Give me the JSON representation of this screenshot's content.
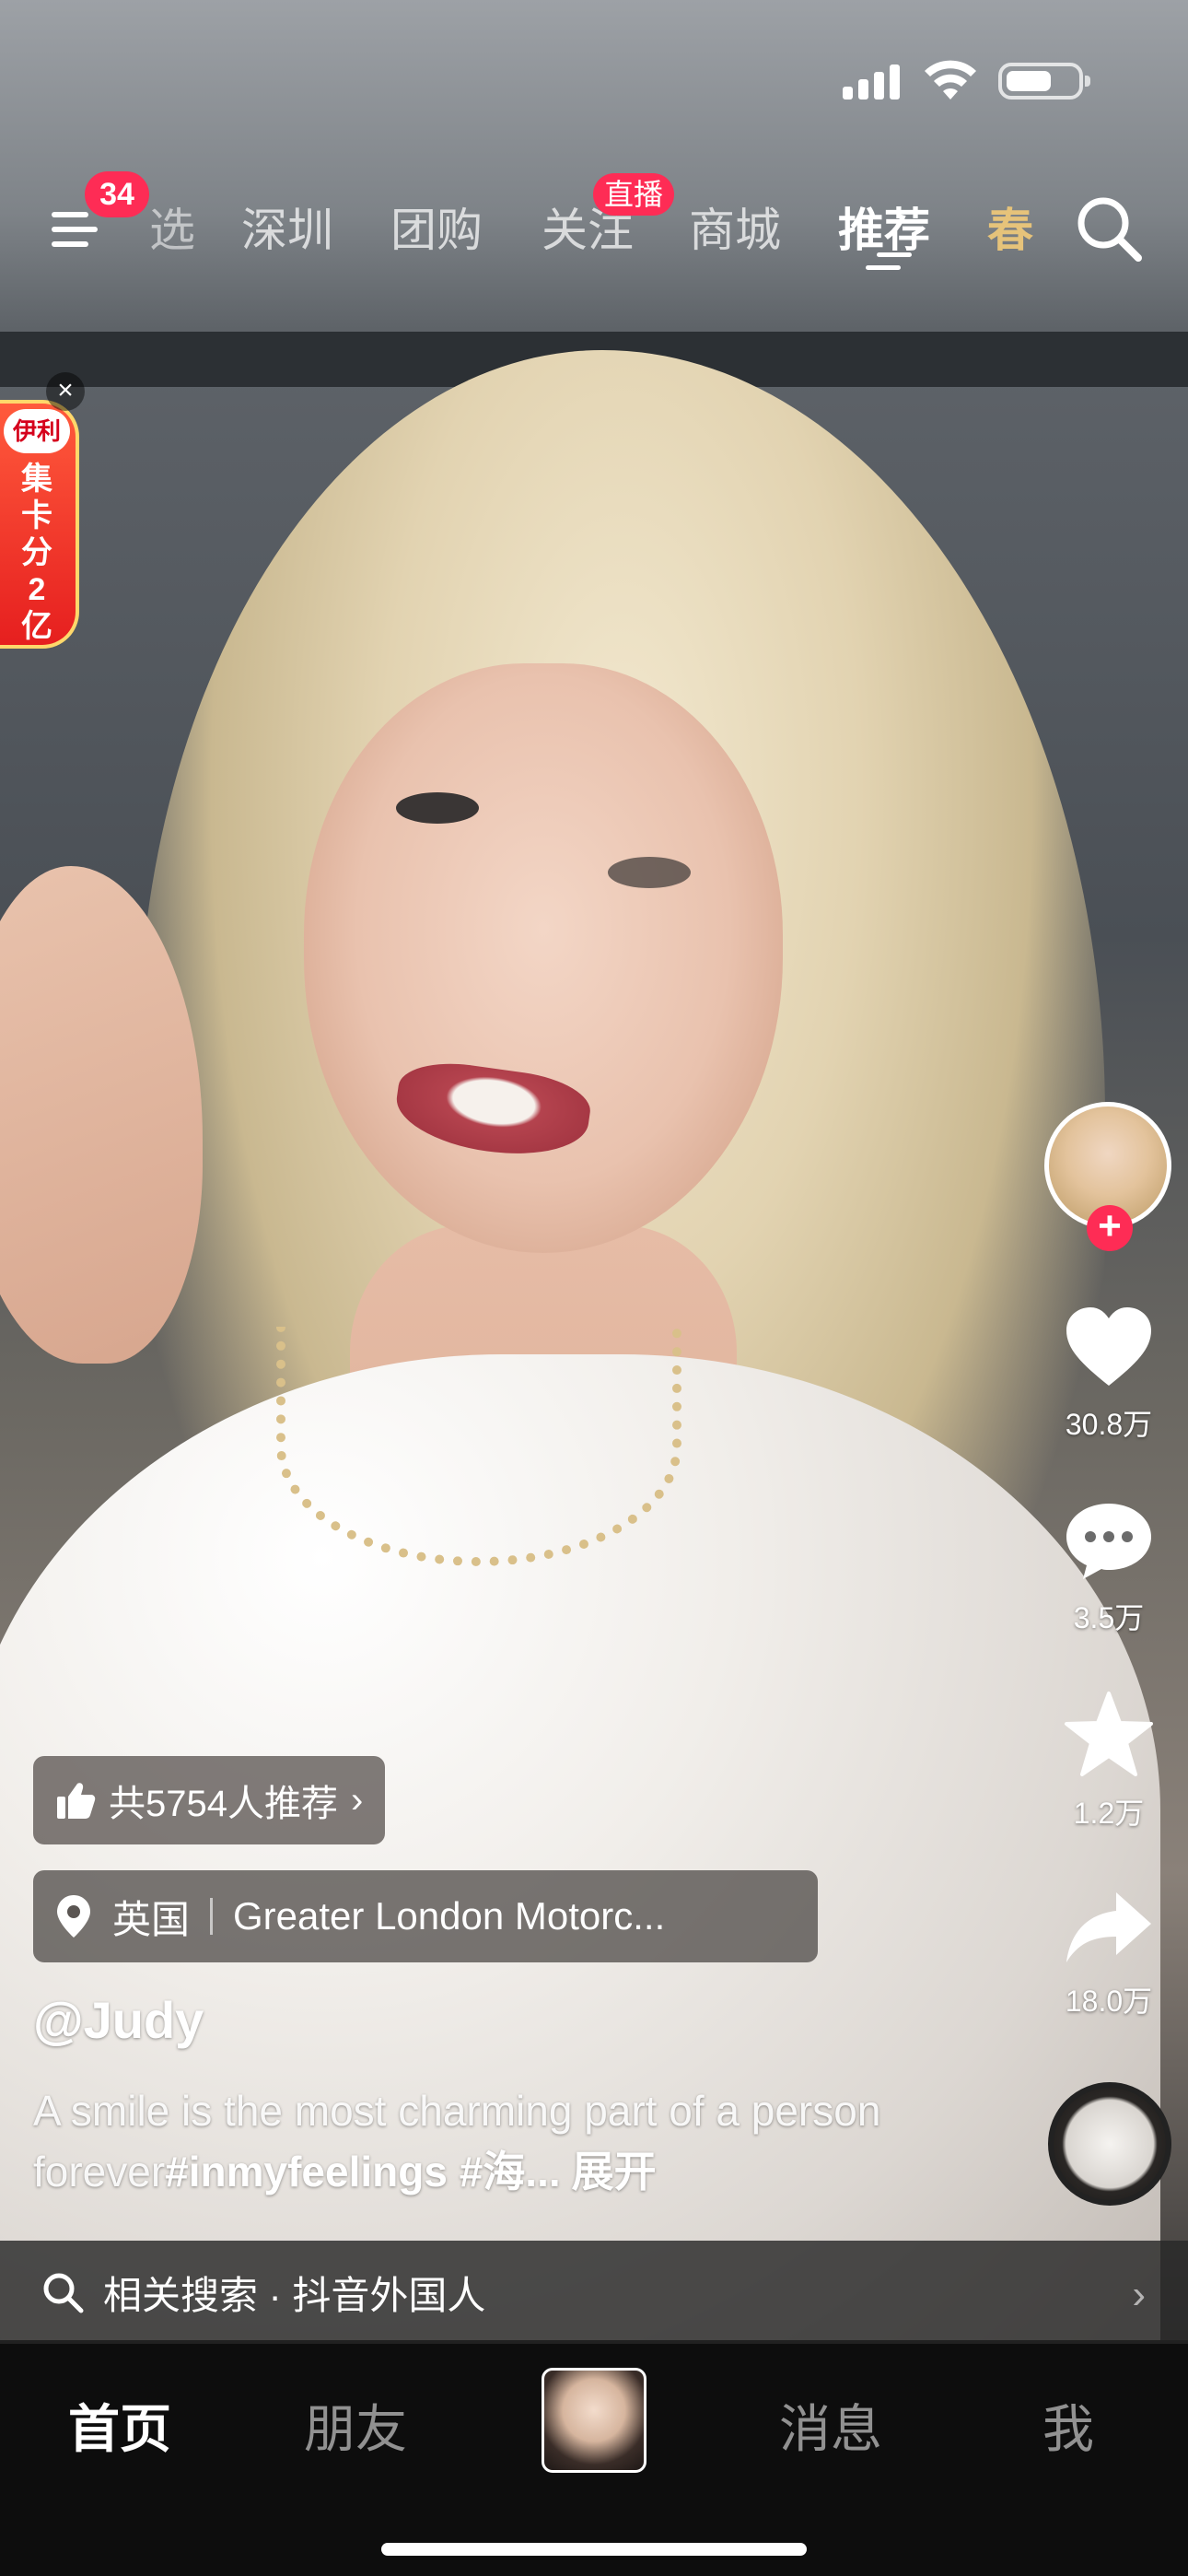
{
  "nav": {
    "notification_count": "34",
    "tabs": [
      "选",
      "深圳",
      "团购",
      "关注",
      "商城",
      "推荐",
      "春"
    ],
    "live_badge": "直播",
    "active_tab": "推荐"
  },
  "promo": {
    "logo": "伊利",
    "text": "集卡分2亿",
    "close": "×"
  },
  "actions": {
    "likes": "30.8万",
    "comments": "3.5万",
    "favorites": "1.2万",
    "shares": "18.0万"
  },
  "info": {
    "recommend": "共5754人推荐",
    "location_country": "英国",
    "location_place": "Greater London Motorc...",
    "username": "@Judy",
    "caption_text": "A smile is the most charming part of a person forever",
    "caption_hashtags": "#inmyfeelings #海...",
    "caption_more": "展开",
    "related_search": "相关搜索 · 抖音外国人"
  },
  "tabbar": {
    "home": "首页",
    "friends": "朋友",
    "messages": "消息",
    "me": "我"
  },
  "icons": {
    "menu": "menu-icon",
    "search": "search-icon",
    "like": "heart-icon",
    "comment": "comment-icon",
    "favorite": "star-icon",
    "share": "share-icon",
    "location": "location-pin-icon",
    "thumbs_up": "thumbs-up-icon"
  },
  "colors": {
    "accent": "#fe2c55",
    "spring_tab": "#e6c37a"
  }
}
